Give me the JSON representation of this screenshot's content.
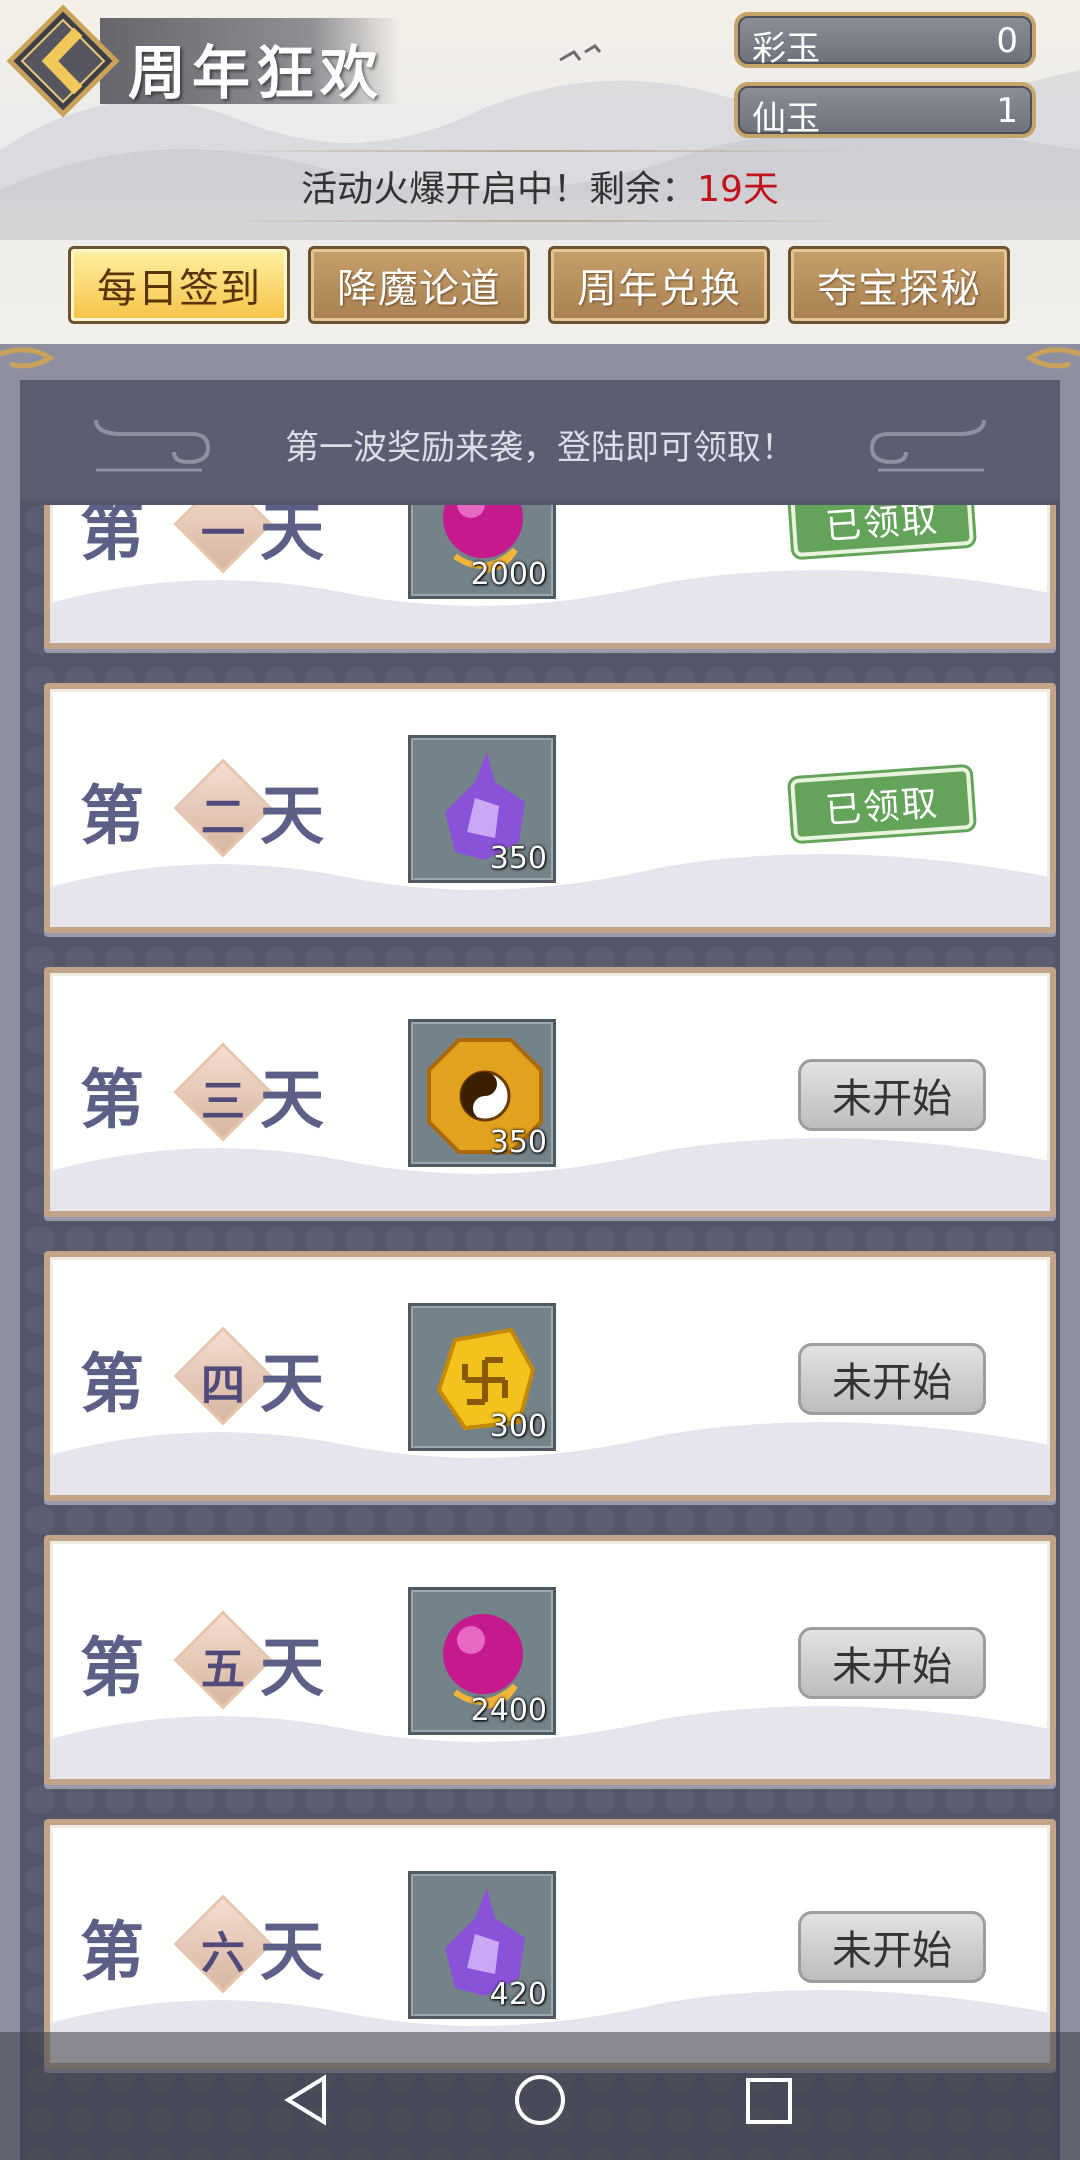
{
  "header": {
    "title": "周年狂欢",
    "currencies": [
      {
        "label": "彩玉",
        "value": "0"
      },
      {
        "label": "仙玉",
        "value": "1"
      }
    ],
    "notice_prefix": "活动火爆开启中！剩余：",
    "notice_days": "19天"
  },
  "tabs": [
    {
      "label": "每日签到",
      "active": true
    },
    {
      "label": "降魔论道",
      "active": false
    },
    {
      "label": "周年兑换",
      "active": false
    },
    {
      "label": "夺宝探秘",
      "active": false
    }
  ],
  "panel": {
    "heading": "第一波奖励来袭，登陆即可领取！"
  },
  "days": [
    {
      "prefix": "第",
      "number": "一",
      "suffix": "天",
      "item_icon": "pink-orb-icon",
      "quantity": "2000",
      "status": "已领取"
    },
    {
      "prefix": "第",
      "number": "二",
      "suffix": "天",
      "item_icon": "purple-crystal-icon",
      "quantity": "350",
      "status": "已领取"
    },
    {
      "prefix": "第",
      "number": "三",
      "suffix": "天",
      "item_icon": "bagua-icon",
      "quantity": "350",
      "status": "未开始"
    },
    {
      "prefix": "第",
      "number": "四",
      "suffix": "天",
      "item_icon": "gold-swastika-stone-icon",
      "quantity": "300",
      "status": "未开始"
    },
    {
      "prefix": "第",
      "number": "五",
      "suffix": "天",
      "item_icon": "pink-orb-icon",
      "quantity": "2400",
      "status": "未开始"
    },
    {
      "prefix": "第",
      "number": "六",
      "suffix": "天",
      "item_icon": "purple-crystal-icon",
      "quantity": "420",
      "status": "未开始"
    }
  ],
  "colors": {
    "claimed_stamp": "#64a45a",
    "days_remaining": "#c0121a",
    "active_tab": "#f5c246"
  }
}
